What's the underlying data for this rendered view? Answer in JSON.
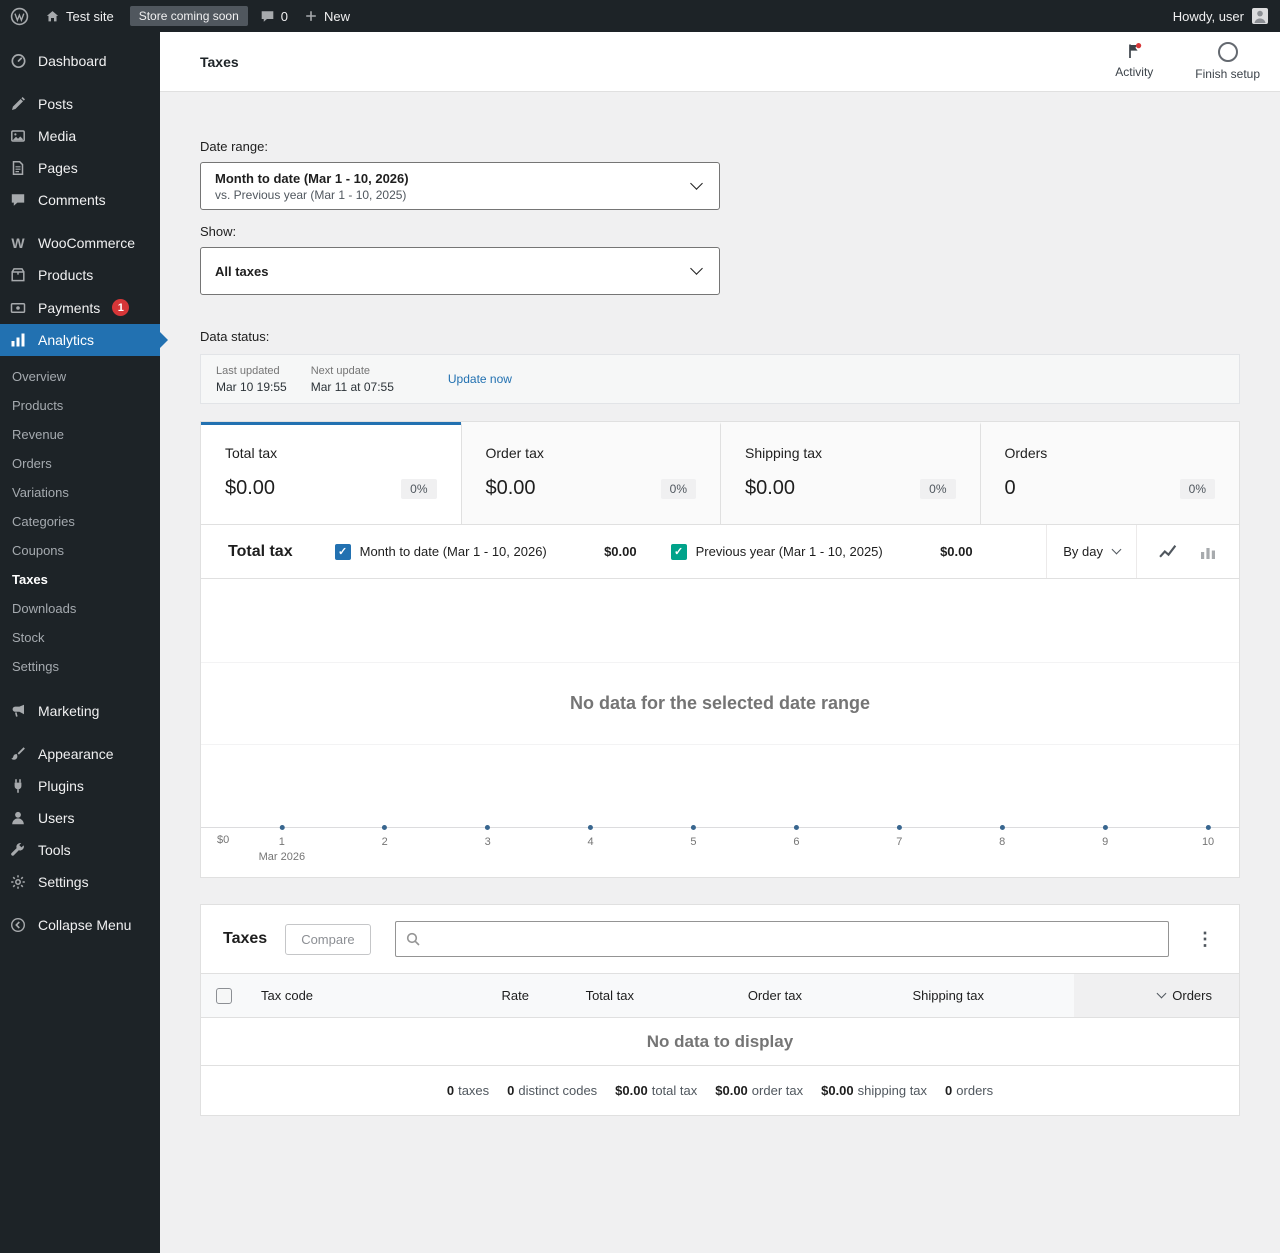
{
  "admin_bar": {
    "site_name": "Test site",
    "coming_soon_badge": "Store coming soon",
    "comments_count": "0",
    "new_label": "New",
    "howdy_text": "Howdy, user"
  },
  "sidebar": {
    "items": [
      {
        "label": "Dashboard"
      },
      {
        "label": "Posts"
      },
      {
        "label": "Media"
      },
      {
        "label": "Pages"
      },
      {
        "label": "Comments"
      },
      {
        "label": "WooCommerce"
      },
      {
        "label": "Products"
      },
      {
        "label": "Payments",
        "badge": "1"
      },
      {
        "label": "Analytics"
      },
      {
        "label": "Marketing"
      },
      {
        "label": "Appearance"
      },
      {
        "label": "Plugins"
      },
      {
        "label": "Users"
      },
      {
        "label": "Tools"
      },
      {
        "label": "Settings"
      },
      {
        "label": "Collapse Menu"
      }
    ],
    "analytics_submenu": [
      {
        "label": "Overview"
      },
      {
        "label": "Products"
      },
      {
        "label": "Revenue"
      },
      {
        "label": "Orders"
      },
      {
        "label": "Variations"
      },
      {
        "label": "Categories"
      },
      {
        "label": "Coupons"
      },
      {
        "label": "Taxes"
      },
      {
        "label": "Downloads"
      },
      {
        "label": "Stock"
      },
      {
        "label": "Settings"
      }
    ]
  },
  "header": {
    "title": "Taxes",
    "activity_label": "Activity",
    "finish_setup_label": "Finish setup"
  },
  "filters": {
    "date_range_label": "Date range:",
    "date_range_value": "Month to date (Mar 1 - 10, 2026)",
    "date_range_compare": "vs. Previous year (Mar 1 - 10, 2025)",
    "show_label": "Show:",
    "show_value": "All taxes"
  },
  "data_status": {
    "section_label": "Data status:",
    "last_updated_label": "Last updated",
    "last_updated_value": "Mar 10 19:55",
    "next_update_label": "Next update",
    "next_update_value": "Mar 11 at 07:55",
    "update_now_label": "Update now"
  },
  "summary_tiles": [
    {
      "label": "Total tax",
      "value": "$0.00",
      "delta": "0%"
    },
    {
      "label": "Order tax",
      "value": "$0.00",
      "delta": "0%"
    },
    {
      "label": "Shipping tax",
      "value": "$0.00",
      "delta": "0%"
    },
    {
      "label": "Orders",
      "value": "0",
      "delta": "0%"
    }
  ],
  "chart": {
    "title": "Total tax",
    "legend": [
      {
        "label": "Month to date (Mar 1 - 10, 2026)",
        "value": "$0.00",
        "color": "#2271b1"
      },
      {
        "label": "Previous year (Mar 1 - 10, 2025)",
        "value": "$0.00",
        "color": "#00a38a"
      }
    ],
    "interval": "By day",
    "line_chart_icon": "line-chart",
    "bar_chart_icon": "bar-chart",
    "empty_message": "No data for the selected date range",
    "y_zero_label": "$0",
    "x_month_label": "Mar 2026"
  },
  "chart_data": {
    "type": "line",
    "title": "Total tax",
    "x": [
      "1",
      "2",
      "3",
      "4",
      "5",
      "6",
      "7",
      "8",
      "9",
      "10"
    ],
    "x_axis_annotation": "Mar 2026",
    "series": [
      {
        "name": "Month to date (Mar 1 - 10, 2026)",
        "values": [
          0,
          0,
          0,
          0,
          0,
          0,
          0,
          0,
          0,
          0
        ]
      },
      {
        "name": "Previous year (Mar 1 - 10, 2025)",
        "values": [
          0,
          0,
          0,
          0,
          0,
          0,
          0,
          0,
          0,
          0
        ]
      }
    ],
    "y_start_label": "$0",
    "legend_position": "top",
    "grid": "horizontal",
    "empty_message": "No data for the selected date range"
  },
  "table": {
    "title": "Taxes",
    "compare_label": "Compare",
    "columns": [
      "Tax code",
      "Rate",
      "Total tax",
      "Order tax",
      "Shipping tax",
      "Orders"
    ],
    "sorted_column": "Orders",
    "empty_message": "No data to display",
    "summary": [
      {
        "value": "0",
        "label": "taxes"
      },
      {
        "value": "0",
        "label": "distinct codes"
      },
      {
        "value": "$0.00",
        "label": "total tax"
      },
      {
        "value": "$0.00",
        "label": "order tax"
      },
      {
        "value": "$0.00",
        "label": "shipping tax"
      },
      {
        "value": "0",
        "label": "orders"
      }
    ]
  }
}
